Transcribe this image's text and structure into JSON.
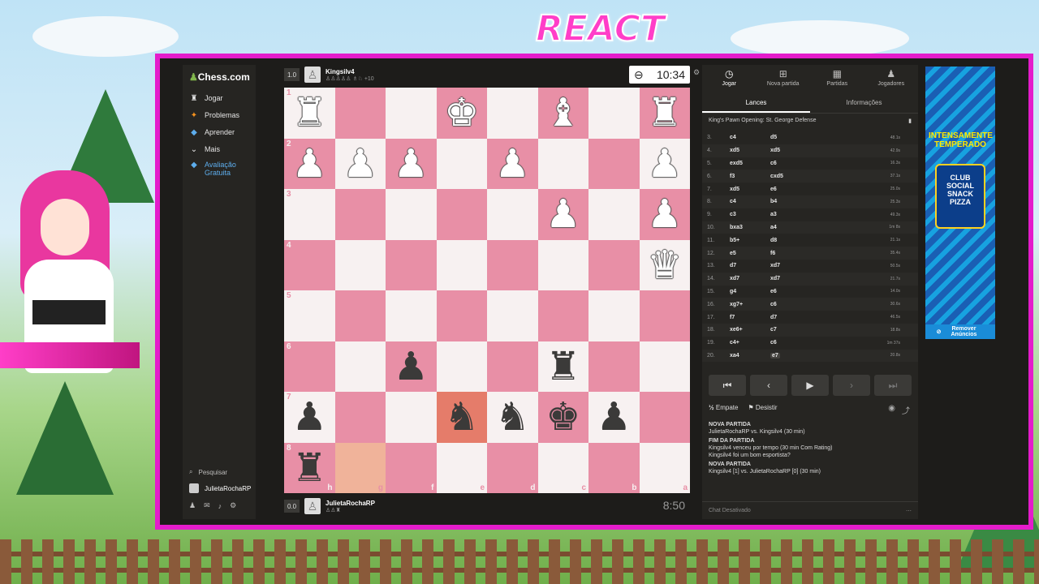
{
  "overlay": {
    "title": "REACT"
  },
  "sidebar": {
    "logo": "Chess.com",
    "items": [
      {
        "label": "Jogar",
        "icon": "play-icon"
      },
      {
        "label": "Problemas",
        "icon": "puzzle-icon"
      },
      {
        "label": "Aprender",
        "icon": "learn-icon"
      },
      {
        "label": "Mais",
        "icon": "chevron-down-icon"
      },
      {
        "label": "Avaliação Gratuita",
        "icon": "diamond-icon"
      }
    ],
    "search": "Pesquisar",
    "user": "JulietaRochaRP"
  },
  "top_player": {
    "rating": "1.0",
    "name": "Kingsilv4",
    "extra": "+10",
    "clock": "10:34"
  },
  "bottom_player": {
    "rating": "0.0",
    "name": "JulietaRochaRP",
    "clock": "8:50"
  },
  "board": {
    "ranks": [
      "1",
      "2",
      "3",
      "4",
      "5",
      "6",
      "7",
      "8"
    ],
    "files": [
      "h",
      "g",
      "f",
      "e",
      "d",
      "c",
      "b",
      "a"
    ],
    "squares": [
      [
        "wR",
        "",
        "",
        "wK",
        "",
        "wB",
        "",
        "wR"
      ],
      [
        "wP",
        "wP",
        "wP",
        "",
        "wP",
        "",
        "",
        "wP"
      ],
      [
        "",
        "",
        "",
        "",
        "",
        "wP",
        "",
        "wP"
      ],
      [
        "",
        "",
        "",
        "",
        "",
        "",
        "",
        "wQ"
      ],
      [
        "",
        "",
        "",
        "",
        "",
        "",
        "",
        ""
      ],
      [
        "",
        "",
        "bP",
        "",
        "",
        "bR",
        "",
        ""
      ],
      [
        "bP",
        "",
        "",
        "bN",
        "bN",
        "bK",
        "bP",
        ""
      ],
      [
        "bR",
        "",
        "",
        "",
        "",
        "",
        "",
        ""
      ]
    ],
    "highlight": [
      [
        6,
        3
      ],
      [
        7,
        1
      ]
    ]
  },
  "panel": {
    "tabs": [
      {
        "label": "Jogar",
        "icon": "stopwatch-icon"
      },
      {
        "label": "Nova partida",
        "icon": "plus-icon"
      },
      {
        "label": "Partidas",
        "icon": "board-icon"
      },
      {
        "label": "Jogadores",
        "icon": "players-icon"
      }
    ],
    "subtabs": [
      "Lances",
      "Informações"
    ],
    "opening": "King's Pawn Opening: St. George Defense",
    "moves": [
      {
        "n": "3.",
        "w": "c4",
        "b": "d5",
        "t": "48.1s"
      },
      {
        "n": "4.",
        "w": "xd5",
        "b": "xd5",
        "t": "42.9s"
      },
      {
        "n": "5.",
        "w": "exd5",
        "b": "c6",
        "t": "16.3s"
      },
      {
        "n": "6.",
        "w": "f3",
        "b": "cxd5",
        "t": "37.1s"
      },
      {
        "n": "7.",
        "w": "xd5",
        "b": "e6",
        "t": "25.0s"
      },
      {
        "n": "8.",
        "w": "c4",
        "b": "b4",
        "t": "25.3s"
      },
      {
        "n": "9.",
        "w": "c3",
        "b": "a3",
        "t": "49.3s"
      },
      {
        "n": "10.",
        "w": "bxa3",
        "b": "a4",
        "t": "1m 8s"
      },
      {
        "n": "11.",
        "w": "b5+",
        "b": "d8",
        "t": "21.1s"
      },
      {
        "n": "12.",
        "w": "e5",
        "b": "f6",
        "t": "35.4s"
      },
      {
        "n": "13.",
        "w": "d7",
        "b": "xd7",
        "t": "50.5s"
      },
      {
        "n": "14.",
        "w": "xd7",
        "b": "xd7",
        "t": "21.7s"
      },
      {
        "n": "15.",
        "w": "g4",
        "b": "e6",
        "t": "14.0s"
      },
      {
        "n": "16.",
        "w": "xg7+",
        "b": "c6",
        "t": "30.6s"
      },
      {
        "n": "17.",
        "w": "f7",
        "b": "d7",
        "t": "46.5s"
      },
      {
        "n": "18.",
        "w": "xe6+",
        "b": "c7",
        "t": "18.8s"
      },
      {
        "n": "19.",
        "w": "c4+",
        "b": "c6",
        "t": "1m 37s"
      },
      {
        "n": "20.",
        "w": "xa4",
        "b": "e7",
        "t": "20.8s"
      }
    ],
    "controls": [
      "first-icon",
      "prev-icon",
      "play-icon",
      "next-icon",
      "last-icon"
    ],
    "draw_label": "Empate",
    "resign_label": "Desistir",
    "chat": [
      {
        "head": "NOVA PARTIDA",
        "line": "JulietaRochaRP vs. Kingsilv4 (30 min)"
      },
      {
        "head": "FIM DA PARTIDA",
        "line": "Kingsilv4 venceu por tempo (30 min Com Rating)"
      },
      {
        "head": "",
        "line": "Kingsilv4 foi um bom esportista?"
      },
      {
        "head": "NOVA PARTIDA",
        "line": "Kingsilv4 [1] vs. JulietaRochaRP [0] (30 min)"
      }
    ],
    "chat_disabled": "Chat Desativado"
  },
  "ad": {
    "headline": "INTENSAMENTE TEMPERADO",
    "product": "CLUB SOCIAL SNACK PIZZA",
    "remove": "Remover Anúncios"
  },
  "colors": {
    "light_square": "#f7f1f1",
    "dark_square": "#e88fa6",
    "frame": "#e41ccb"
  }
}
